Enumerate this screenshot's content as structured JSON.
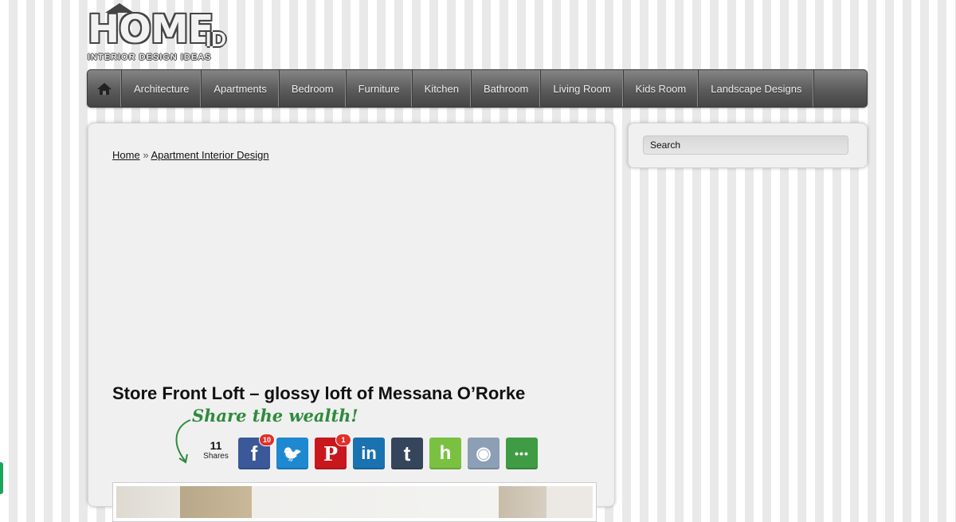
{
  "logo": {
    "word": "HOME",
    "suffix": "ID",
    "tagline": "INTERIOR DESIGN IDEAS"
  },
  "nav": {
    "home_icon": "home-icon",
    "items": [
      "Architecture",
      "Apartments",
      "Bedroom",
      "Furniture",
      "Kitchen",
      "Bathroom",
      "Living Room",
      "Kids Room",
      "Landscape Designs"
    ]
  },
  "breadcrumb": {
    "home": "Home",
    "separator": "»",
    "category": "Apartment Interior Design"
  },
  "post": {
    "title": "Store Front Loft – glossy loft of Messana O’Rorke"
  },
  "share": {
    "heading": "Share the wealth!",
    "count": "11",
    "count_label": "Shares",
    "buttons": [
      {
        "name": "facebook",
        "glyph": "f",
        "color": "#3b5998",
        "badge": "10"
      },
      {
        "name": "twitter",
        "glyph": "🐦",
        "color": "#1e88d0",
        "badge": ""
      },
      {
        "name": "pinterest",
        "glyph": "P",
        "color": "#c9171e",
        "badge": "1"
      },
      {
        "name": "linkedin",
        "glyph": "in",
        "color": "#1a72b0",
        "badge": ""
      },
      {
        "name": "tumblr",
        "glyph": "t",
        "color": "#35465c",
        "badge": ""
      },
      {
        "name": "houzz",
        "glyph": "h",
        "color": "#7ac142",
        "badge": ""
      },
      {
        "name": "reddit",
        "glyph": "◉",
        "color": "#8d9fb5",
        "badge": ""
      },
      {
        "name": "more",
        "glyph": "•••",
        "color": "#3f9b44",
        "badge": ""
      }
    ]
  },
  "sidebar": {
    "search_value": "Search"
  },
  "colors": {
    "nav": "#5b5b5b",
    "panel": "#f0f0f0",
    "share_accent": "#2e8b3c"
  }
}
